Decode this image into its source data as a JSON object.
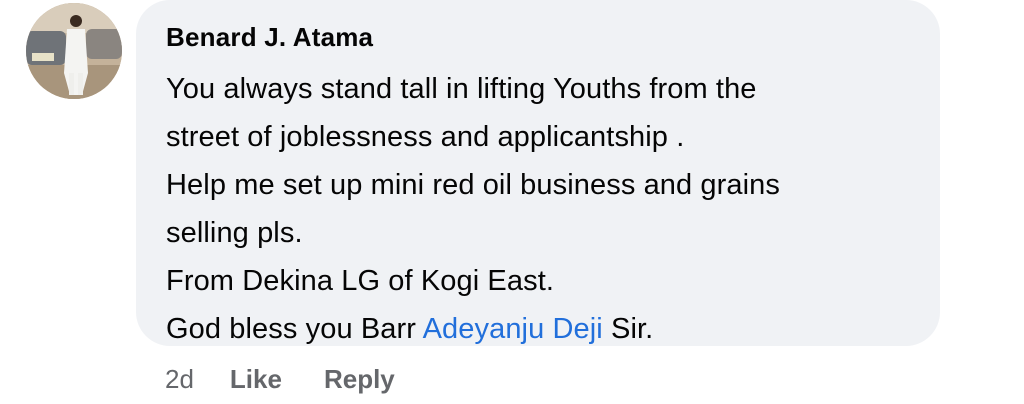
{
  "comment": {
    "author": "Benard J. Atama",
    "lines": [
      "You always stand tall in lifting Youths from the",
      "street of joblessness and applicantship .",
      "Help me set up mini red oil business and grains",
      "selling pls.",
      "From Dekina LG of Kogi East."
    ],
    "last_line": {
      "prefix": "God bless you Barr ",
      "mention": "Adeyanju Deji",
      "suffix": " Sir."
    },
    "mention_color": "#216fdb",
    "bubble_color": "#f0f2f5"
  },
  "actions": {
    "timestamp": "2d",
    "like_label": "Like",
    "reply_label": "Reply"
  }
}
